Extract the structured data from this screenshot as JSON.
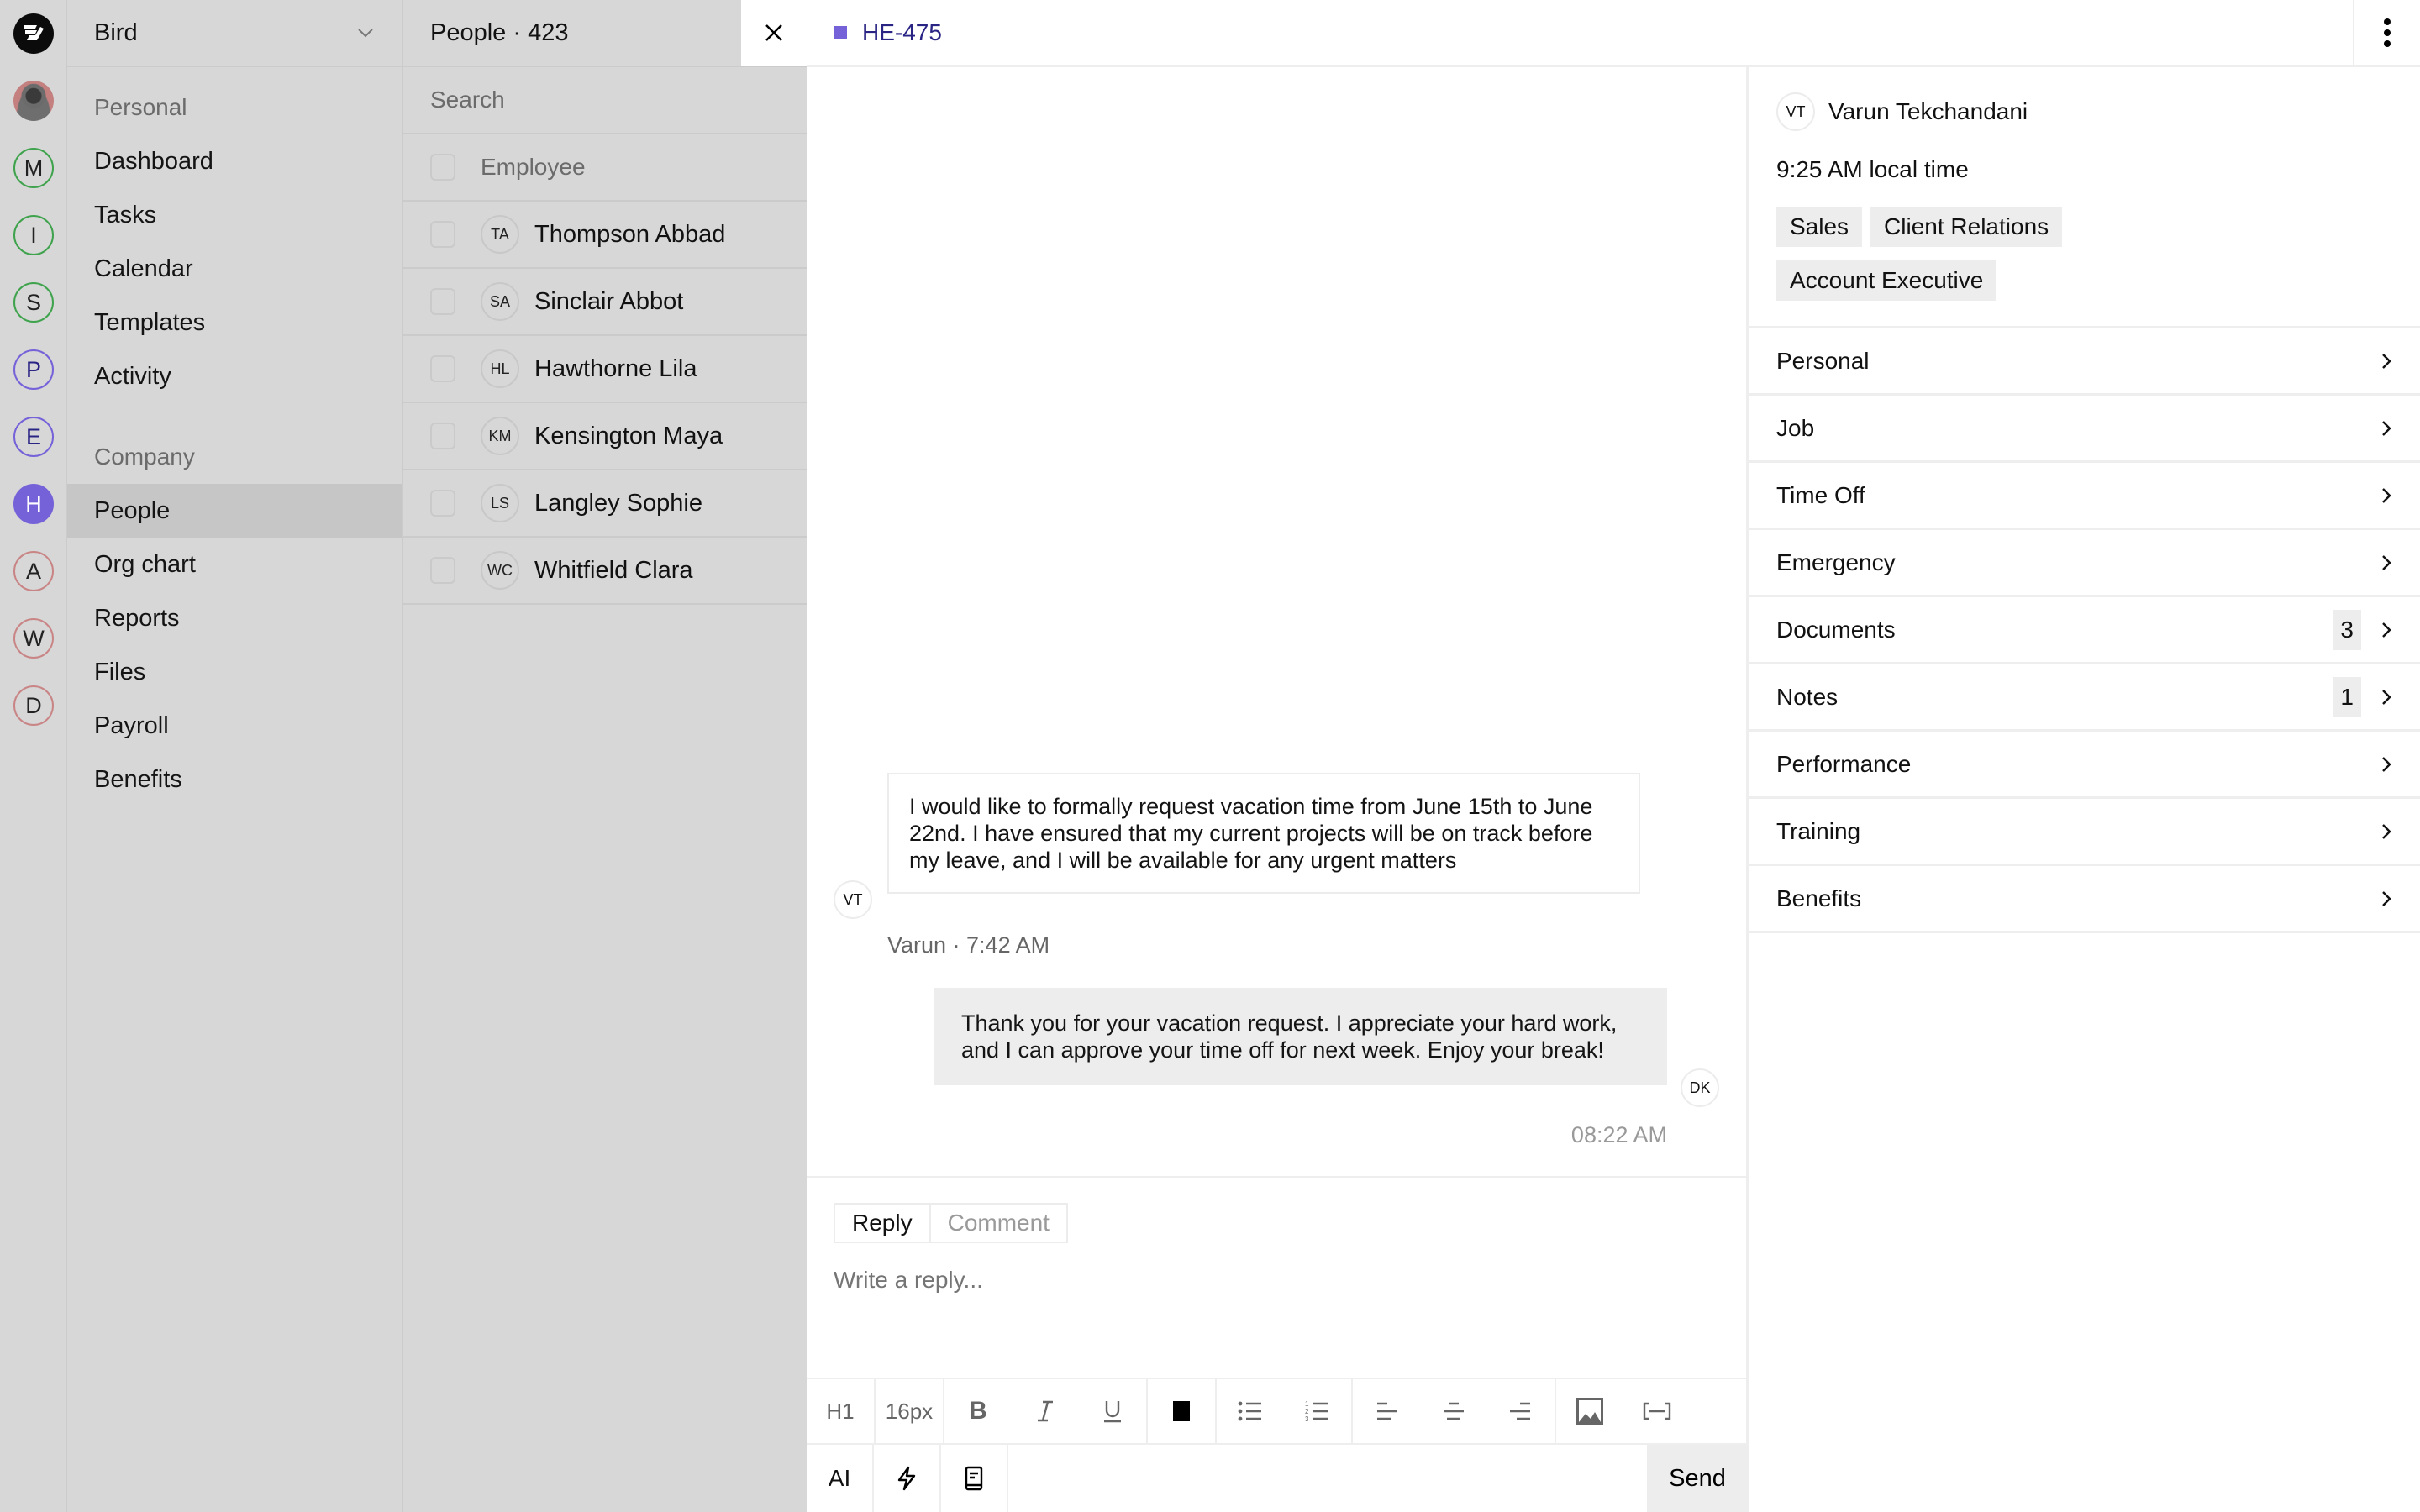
{
  "app": {
    "workspace_name": "Bird"
  },
  "rail": {
    "workspaces": [
      {
        "letter": "M",
        "ring": "#3fa34d"
      },
      {
        "letter": "I",
        "ring": "#3fa34d"
      },
      {
        "letter": "S",
        "ring": "#3fa34d"
      },
      {
        "letter": "P",
        "ring": "#7562d9"
      },
      {
        "letter": "E",
        "ring": "#7562d9"
      },
      {
        "letter": "H",
        "ring": "#7562d9",
        "active": true
      },
      {
        "letter": "A",
        "ring": "#c98585"
      },
      {
        "letter": "W",
        "ring": "#c98585"
      },
      {
        "letter": "D",
        "ring": "#c98585"
      }
    ]
  },
  "sidebar": {
    "personal_label": "Personal",
    "personal_items": [
      "Dashboard",
      "Tasks",
      "Calendar",
      "Templates",
      "Activity"
    ],
    "company_label": "Company",
    "company_items": [
      "People",
      "Org chart",
      "Reports",
      "Files",
      "Payroll",
      "Benefits"
    ],
    "active_item": "People"
  },
  "people": {
    "title": "People · 423",
    "search_placeholder": "Search",
    "column_header": "Employee",
    "rows": [
      {
        "initials": "TA",
        "name": "Thompson Abbad"
      },
      {
        "initials": "SA",
        "name": "Sinclair Abbot"
      },
      {
        "initials": "HL",
        "name": "Hawthorne Lila"
      },
      {
        "initials": "KM",
        "name": "Kensington Maya"
      },
      {
        "initials": "LS",
        "name": "Langley Sophie"
      },
      {
        "initials": "WC",
        "name": "Whitfield Clara"
      }
    ]
  },
  "ticket": {
    "id": "HE-475",
    "color": "#7562d9"
  },
  "messages": [
    {
      "initials": "VT",
      "text": "I would like to formally request vacation time from June 15th to June 22nd. I have ensured that my current projects will be on track before my leave, and I will be available for any urgent matters",
      "meta": "Varun · 7:42 AM",
      "direction": "incoming"
    },
    {
      "initials": "DK",
      "text": "Thank you for your vacation request. I appreciate your hard work, and I can approve your time off for next week. Enjoy your break!",
      "meta": "08:22 AM",
      "direction": "outgoing"
    }
  ],
  "composer": {
    "tabs": [
      "Reply",
      "Comment"
    ],
    "active_tab": "Reply",
    "placeholder": "Write a reply...",
    "heading_label": "H1",
    "font_size": "16px",
    "ai_label": "AI",
    "send_label": "Send"
  },
  "profile": {
    "initials": "VT",
    "name": "Varun Tekchandani",
    "local_time": "9:25 AM local time",
    "tags": [
      "Sales",
      "Client Relations",
      "Account Executive"
    ],
    "sections": [
      {
        "label": "Personal"
      },
      {
        "label": "Job"
      },
      {
        "label": "Time Off"
      },
      {
        "label": "Emergency"
      },
      {
        "label": "Documents",
        "count": "3"
      },
      {
        "label": "Notes",
        "count": "1"
      },
      {
        "label": "Performance"
      },
      {
        "label": "Training"
      },
      {
        "label": "Benefits"
      }
    ]
  }
}
